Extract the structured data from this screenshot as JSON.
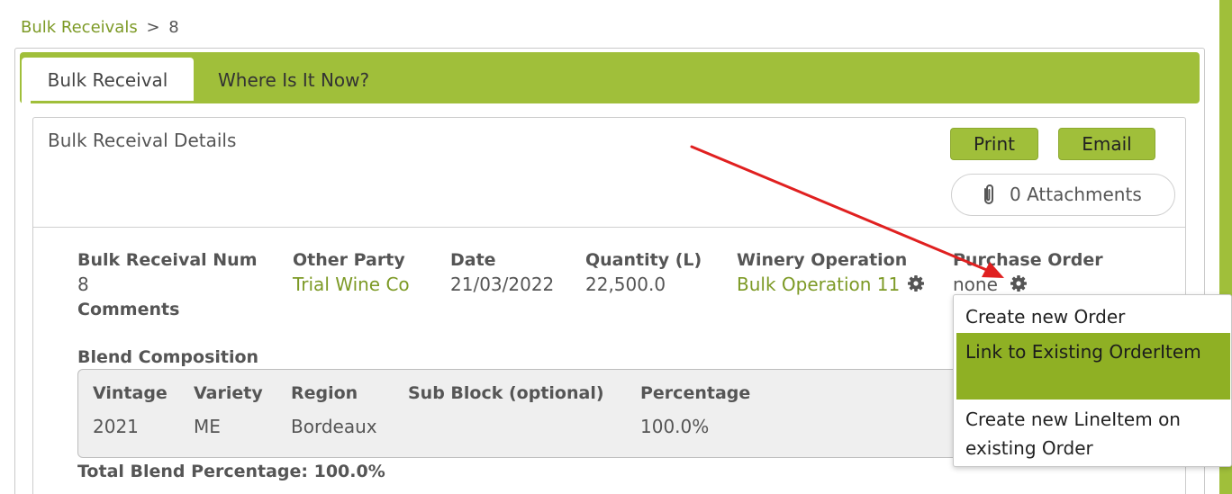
{
  "breadcrumb": {
    "parent": "Bulk Receivals",
    "separator": ">",
    "current": "8"
  },
  "tabs": [
    {
      "label": "Bulk Receival",
      "active": true
    },
    {
      "label": "Where Is It Now?",
      "active": false
    }
  ],
  "details": {
    "title": "Bulk Receival Details",
    "print_label": "Print",
    "email_label": "Email",
    "attachments_label": "0 Attachments"
  },
  "fields": {
    "num_label": "Bulk Receival Num",
    "num_value": "8",
    "party_label": "Other Party",
    "party_value": "Trial Wine Co",
    "date_label": "Date",
    "date_value": "21/03/2022",
    "qty_label": "Quantity (L)",
    "qty_value": "22,500.0",
    "op_label": "Winery Operation",
    "op_value": "Bulk Operation 11",
    "po_label": "Purchase Order",
    "po_value": "none",
    "comments_label": "Comments"
  },
  "blend": {
    "title": "Blend Composition",
    "columns": [
      "Vintage",
      "Variety",
      "Region",
      "Sub Block (optional)",
      "Percentage"
    ],
    "rows": [
      [
        "2021",
        "ME",
        "Bordeaux",
        "",
        "100.0%"
      ]
    ],
    "total": "Total Blend Percentage: 100.0%"
  },
  "dropdown": {
    "items": [
      {
        "label": "Create new Order"
      },
      {
        "label": "Link to Existing OrderItem",
        "highlighted": true
      },
      {
        "label": "Create new LineItem on existing Order"
      }
    ]
  },
  "colors": {
    "accent": "#a0bf3a",
    "link": "#7d9a26",
    "highlight": "#8fb024",
    "annotation_arrow": "#e02020"
  },
  "icons": [
    "gear-icon",
    "paperclip-icon"
  ]
}
